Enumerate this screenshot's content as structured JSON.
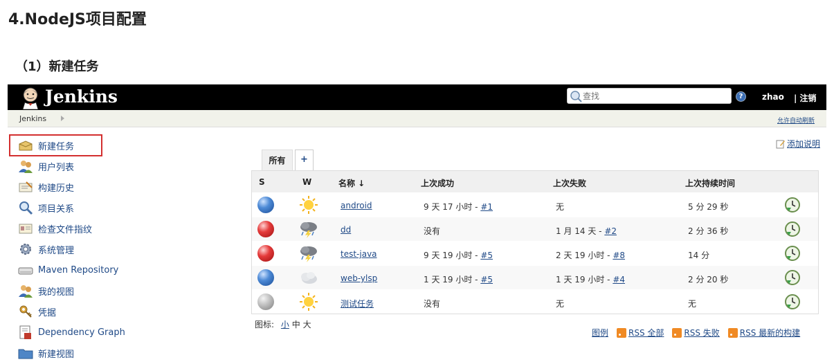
{
  "doc": {
    "heading": "4.NodeJS项目配置",
    "subheading": "（1）新建任务"
  },
  "header": {
    "brand": "Jenkins",
    "search_placeholder": "查找",
    "help": "?",
    "user": "zhao",
    "logout": "| 注销"
  },
  "breadcrumb": {
    "root": "Jenkins",
    "auto_refresh": "允许自动刷新"
  },
  "sidebar": {
    "items": [
      {
        "label": "新建任务",
        "icon": "new-item-icon"
      },
      {
        "label": "用户列表",
        "icon": "users-icon"
      },
      {
        "label": "构建历史",
        "icon": "build-history-icon"
      },
      {
        "label": "项目关系",
        "icon": "search-icon"
      },
      {
        "label": "检查文件指纹",
        "icon": "fingerprint-icon"
      },
      {
        "label": "系统管理",
        "icon": "gear-icon"
      },
      {
        "label": "Maven Repository",
        "icon": "drive-icon"
      },
      {
        "label": "我的视图",
        "icon": "users-icon"
      },
      {
        "label": "凭据",
        "icon": "credentials-icon"
      },
      {
        "label": "Dependency Graph",
        "icon": "graph-icon"
      },
      {
        "label": "新建视图",
        "icon": "folder-icon"
      }
    ]
  },
  "main": {
    "add_description": "添加说明",
    "tabs": [
      {
        "label": "所有"
      },
      {
        "label": "+"
      }
    ],
    "columns": {
      "s": "S",
      "w": "W",
      "name": "名称 ↓",
      "last_success": "上次成功",
      "last_failure": "上次失败",
      "last_duration": "上次持续时间"
    },
    "jobs": [
      {
        "status": "blue",
        "weather": "sunny",
        "name": "android",
        "last_success_text": "9 天 17 小时 - ",
        "last_success_link": "#1",
        "last_failure_text": "无",
        "last_failure_link": "",
        "duration": "5 分 29 秒"
      },
      {
        "status": "red",
        "weather": "storm",
        "name": "dd",
        "last_success_text": "没有",
        "last_success_link": "",
        "last_failure_text": "1 月 14 天 - ",
        "last_failure_link": "#2",
        "duration": "2 分 36 秒"
      },
      {
        "status": "red",
        "weather": "storm",
        "name": "test-java",
        "last_success_text": "9 天 19 小时 - ",
        "last_success_link": "#5",
        "last_failure_text": "2 天 19 小时 - ",
        "last_failure_link": "#8",
        "duration": "14 分"
      },
      {
        "status": "blue",
        "weather": "cloudy",
        "name": "web-ylsp",
        "last_success_text": "1 天 19 小时 - ",
        "last_success_link": "#5",
        "last_failure_text": "1 天 19 小时 - ",
        "last_failure_link": "#4",
        "duration": "2 分 20 秒"
      },
      {
        "status": "grey",
        "weather": "sunny",
        "name": "测试任务",
        "last_success_text": "没有",
        "last_success_link": "",
        "last_failure_text": "无",
        "last_failure_link": "",
        "duration": "无"
      }
    ],
    "icon_size_label": "图标:",
    "icon_sizes": [
      "小",
      "中",
      "大"
    ],
    "feeds": {
      "legend": "图例",
      "rss_all": "RSS 全部",
      "rss_failed": "RSS 失败",
      "rss_latest": "RSS 最新的构建"
    }
  }
}
